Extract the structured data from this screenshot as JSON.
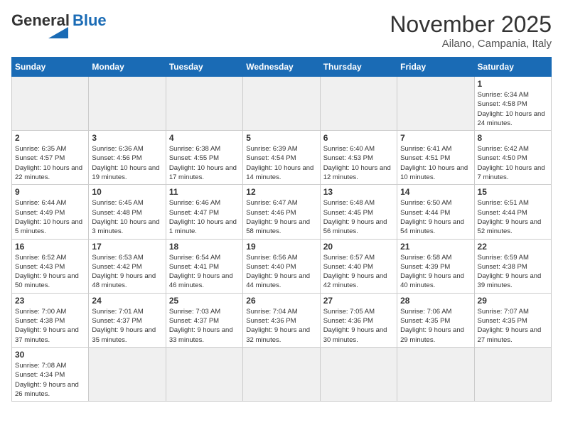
{
  "header": {
    "logo_general": "General",
    "logo_blue": "Blue",
    "month_year": "November 2025",
    "location": "Ailano, Campania, Italy"
  },
  "weekdays": [
    "Sunday",
    "Monday",
    "Tuesday",
    "Wednesday",
    "Thursday",
    "Friday",
    "Saturday"
  ],
  "days": [
    {
      "num": "",
      "info": "",
      "empty": true
    },
    {
      "num": "",
      "info": "",
      "empty": true
    },
    {
      "num": "",
      "info": "",
      "empty": true
    },
    {
      "num": "",
      "info": "",
      "empty": true
    },
    {
      "num": "",
      "info": "",
      "empty": true
    },
    {
      "num": "",
      "info": "",
      "empty": true
    },
    {
      "num": "1",
      "info": "Sunrise: 6:34 AM\nSunset: 4:58 PM\nDaylight: 10 hours and 24 minutes.",
      "empty": false
    },
    {
      "num": "2",
      "info": "Sunrise: 6:35 AM\nSunset: 4:57 PM\nDaylight: 10 hours and 22 minutes.",
      "empty": false
    },
    {
      "num": "3",
      "info": "Sunrise: 6:36 AM\nSunset: 4:56 PM\nDaylight: 10 hours and 19 minutes.",
      "empty": false
    },
    {
      "num": "4",
      "info": "Sunrise: 6:38 AM\nSunset: 4:55 PM\nDaylight: 10 hours and 17 minutes.",
      "empty": false
    },
    {
      "num": "5",
      "info": "Sunrise: 6:39 AM\nSunset: 4:54 PM\nDaylight: 10 hours and 14 minutes.",
      "empty": false
    },
    {
      "num": "6",
      "info": "Sunrise: 6:40 AM\nSunset: 4:53 PM\nDaylight: 10 hours and 12 minutes.",
      "empty": false
    },
    {
      "num": "7",
      "info": "Sunrise: 6:41 AM\nSunset: 4:51 PM\nDaylight: 10 hours and 10 minutes.",
      "empty": false
    },
    {
      "num": "8",
      "info": "Sunrise: 6:42 AM\nSunset: 4:50 PM\nDaylight: 10 hours and 7 minutes.",
      "empty": false
    },
    {
      "num": "9",
      "info": "Sunrise: 6:44 AM\nSunset: 4:49 PM\nDaylight: 10 hours and 5 minutes.",
      "empty": false
    },
    {
      "num": "10",
      "info": "Sunrise: 6:45 AM\nSunset: 4:48 PM\nDaylight: 10 hours and 3 minutes.",
      "empty": false
    },
    {
      "num": "11",
      "info": "Sunrise: 6:46 AM\nSunset: 4:47 PM\nDaylight: 10 hours and 1 minute.",
      "empty": false
    },
    {
      "num": "12",
      "info": "Sunrise: 6:47 AM\nSunset: 4:46 PM\nDaylight: 9 hours and 58 minutes.",
      "empty": false
    },
    {
      "num": "13",
      "info": "Sunrise: 6:48 AM\nSunset: 4:45 PM\nDaylight: 9 hours and 56 minutes.",
      "empty": false
    },
    {
      "num": "14",
      "info": "Sunrise: 6:50 AM\nSunset: 4:44 PM\nDaylight: 9 hours and 54 minutes.",
      "empty": false
    },
    {
      "num": "15",
      "info": "Sunrise: 6:51 AM\nSunset: 4:44 PM\nDaylight: 9 hours and 52 minutes.",
      "empty": false
    },
    {
      "num": "16",
      "info": "Sunrise: 6:52 AM\nSunset: 4:43 PM\nDaylight: 9 hours and 50 minutes.",
      "empty": false
    },
    {
      "num": "17",
      "info": "Sunrise: 6:53 AM\nSunset: 4:42 PM\nDaylight: 9 hours and 48 minutes.",
      "empty": false
    },
    {
      "num": "18",
      "info": "Sunrise: 6:54 AM\nSunset: 4:41 PM\nDaylight: 9 hours and 46 minutes.",
      "empty": false
    },
    {
      "num": "19",
      "info": "Sunrise: 6:56 AM\nSunset: 4:40 PM\nDaylight: 9 hours and 44 minutes.",
      "empty": false
    },
    {
      "num": "20",
      "info": "Sunrise: 6:57 AM\nSunset: 4:40 PM\nDaylight: 9 hours and 42 minutes.",
      "empty": false
    },
    {
      "num": "21",
      "info": "Sunrise: 6:58 AM\nSunset: 4:39 PM\nDaylight: 9 hours and 40 minutes.",
      "empty": false
    },
    {
      "num": "22",
      "info": "Sunrise: 6:59 AM\nSunset: 4:38 PM\nDaylight: 9 hours and 39 minutes.",
      "empty": false
    },
    {
      "num": "23",
      "info": "Sunrise: 7:00 AM\nSunset: 4:38 PM\nDaylight: 9 hours and 37 minutes.",
      "empty": false
    },
    {
      "num": "24",
      "info": "Sunrise: 7:01 AM\nSunset: 4:37 PM\nDaylight: 9 hours and 35 minutes.",
      "empty": false
    },
    {
      "num": "25",
      "info": "Sunrise: 7:03 AM\nSunset: 4:37 PM\nDaylight: 9 hours and 33 minutes.",
      "empty": false
    },
    {
      "num": "26",
      "info": "Sunrise: 7:04 AM\nSunset: 4:36 PM\nDaylight: 9 hours and 32 minutes.",
      "empty": false
    },
    {
      "num": "27",
      "info": "Sunrise: 7:05 AM\nSunset: 4:36 PM\nDaylight: 9 hours and 30 minutes.",
      "empty": false
    },
    {
      "num": "28",
      "info": "Sunrise: 7:06 AM\nSunset: 4:35 PM\nDaylight: 9 hours and 29 minutes.",
      "empty": false
    },
    {
      "num": "29",
      "info": "Sunrise: 7:07 AM\nSunset: 4:35 PM\nDaylight: 9 hours and 27 minutes.",
      "empty": false
    },
    {
      "num": "30",
      "info": "Sunrise: 7:08 AM\nSunset: 4:34 PM\nDaylight: 9 hours and 26 minutes.",
      "empty": false
    },
    {
      "num": "",
      "info": "",
      "empty": true
    },
    {
      "num": "",
      "info": "",
      "empty": true
    },
    {
      "num": "",
      "info": "",
      "empty": true
    },
    {
      "num": "",
      "info": "",
      "empty": true
    },
    {
      "num": "",
      "info": "",
      "empty": true
    },
    {
      "num": "",
      "info": "",
      "empty": true
    }
  ]
}
